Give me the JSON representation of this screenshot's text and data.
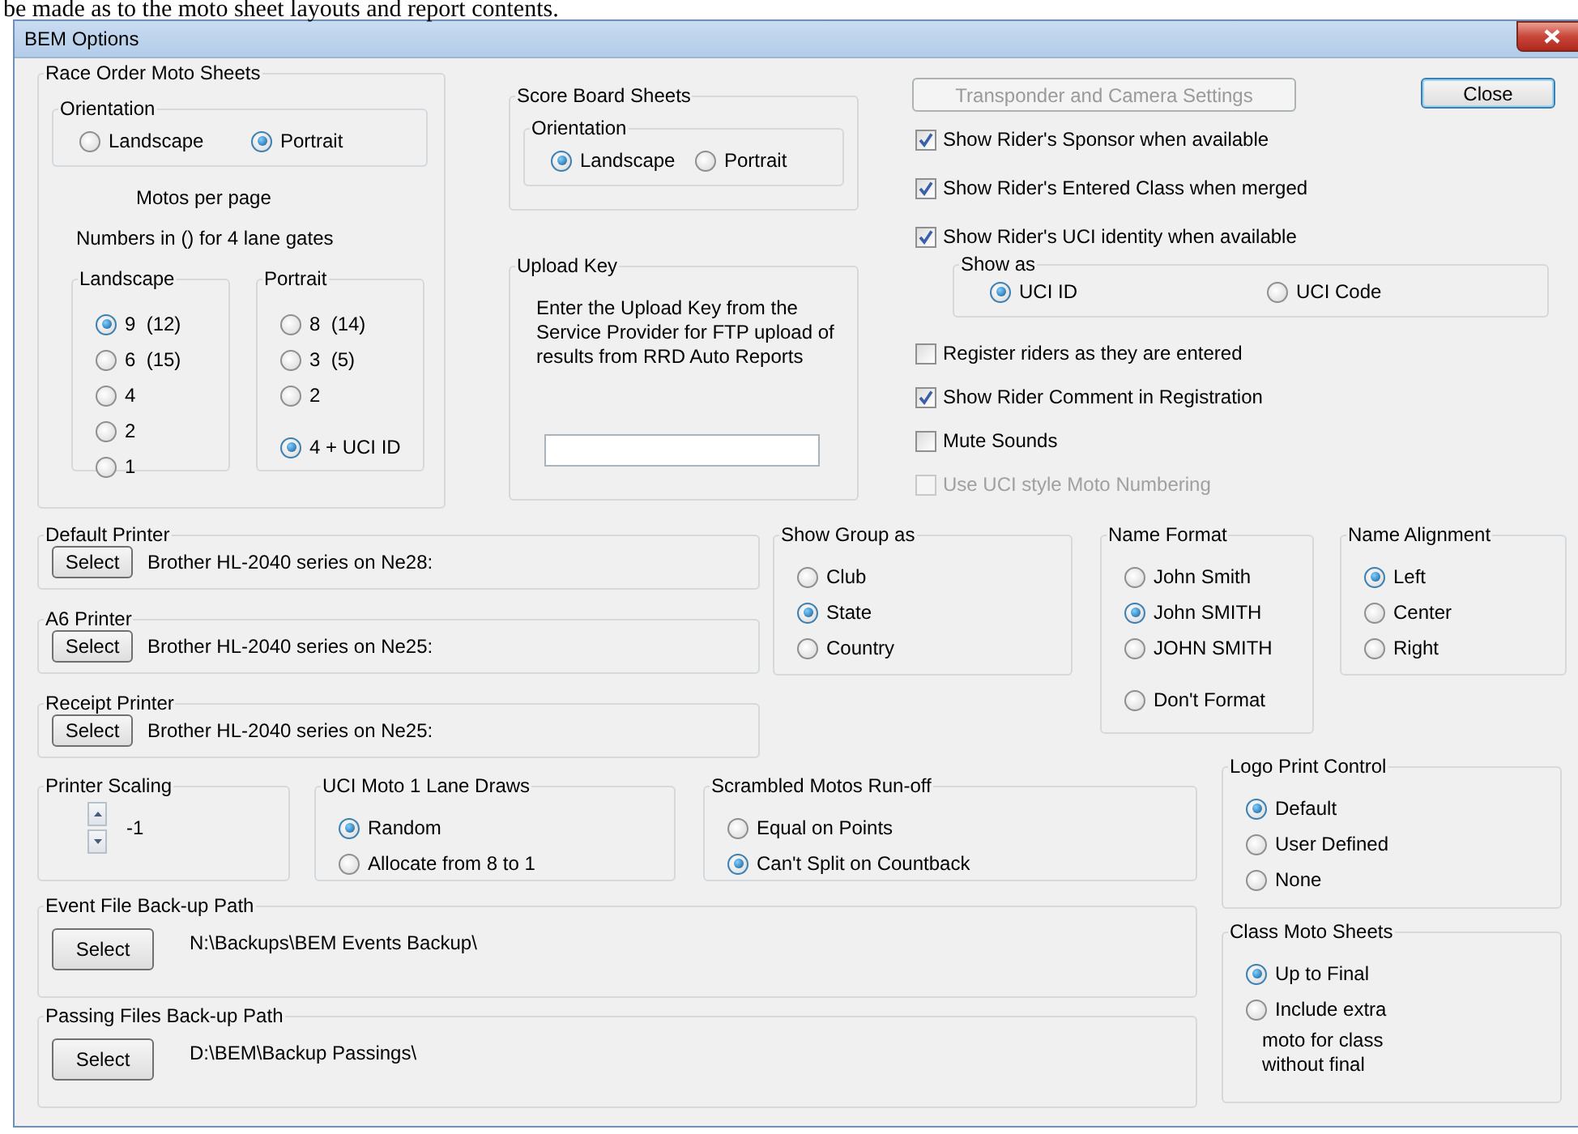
{
  "page_text": "be made as to the moto sheet layouts and report contents.",
  "window": {
    "title": "BEM Options"
  },
  "race_order": {
    "title": "Race Order Moto Sheets",
    "orientation": {
      "title": "Orientation",
      "options": [
        {
          "label": "Landscape",
          "selected": false
        },
        {
          "label": "Portrait",
          "selected": true
        }
      ]
    },
    "motos_label": "Motos per page",
    "numbers_note": "Numbers in () for 4 lane gates",
    "landscape": {
      "title": "Landscape",
      "options": [
        {
          "label": "9  (12)",
          "selected": true
        },
        {
          "label": "6  (15)",
          "selected": false
        },
        {
          "label": "4",
          "selected": false
        },
        {
          "label": "2",
          "selected": false
        },
        {
          "label": "1",
          "selected": false
        }
      ]
    },
    "portrait": {
      "title": "Portrait",
      "options": [
        {
          "label": "8  (14)",
          "selected": false
        },
        {
          "label": "3  (5)",
          "selected": false
        },
        {
          "label": "2",
          "selected": false
        },
        {
          "label": "4 + UCI ID",
          "selected": true
        }
      ]
    }
  },
  "score_board": {
    "title": "Score Board Sheets",
    "orientation": {
      "title": "Orientation",
      "options": [
        {
          "label": "Landscape",
          "selected": true
        },
        {
          "label": "Portrait",
          "selected": false
        }
      ]
    }
  },
  "upload_key": {
    "title": "Upload Key",
    "text": "Enter the Upload Key from the Service Provider for FTP upload of results from RRD Auto Reports"
  },
  "transponder_button": {
    "label": "Transponder and Camera Settings",
    "disabled": true
  },
  "close_button": {
    "label": "Close"
  },
  "settings": [
    {
      "kind": "checkbox",
      "label": "Show Rider's Sponsor when available",
      "checked": true,
      "disabled": false
    },
    {
      "kind": "checkbox",
      "label": "Show Rider's Entered Class when merged",
      "checked": true,
      "disabled": false
    },
    {
      "kind": "checkbox",
      "label": "Show Rider's UCI identity when available",
      "checked": true,
      "disabled": false
    },
    {
      "kind": "group",
      "title": "Show as",
      "options": [
        {
          "label": "UCI ID",
          "selected": true
        },
        {
          "label": "UCI Code",
          "selected": false
        }
      ]
    },
    {
      "kind": "checkbox",
      "label": "Register riders as they are entered",
      "checked": false,
      "disabled": false
    },
    {
      "kind": "checkbox",
      "label": "Show Rider Comment in Registration",
      "checked": true,
      "disabled": false
    },
    {
      "kind": "checkbox",
      "label": "Mute Sounds",
      "checked": false,
      "disabled": false
    },
    {
      "kind": "checkbox",
      "label": "Use UCI style Moto Numbering",
      "checked": false,
      "disabled": true
    }
  ],
  "printers": [
    {
      "title": "Default Printer",
      "button": "Select",
      "value": "Brother HL-2040 series on Ne28:"
    },
    {
      "title": "A6 Printer",
      "button": "Select",
      "value": "Brother HL-2040 series on Ne25:"
    },
    {
      "title": "Receipt Printer",
      "button": "Select",
      "value": "Brother HL-2040 series on Ne25:"
    }
  ],
  "show_group_as": {
    "title": "Show Group as",
    "options": [
      {
        "label": "Club",
        "selected": false
      },
      {
        "label": "State",
        "selected": true
      },
      {
        "label": "Country",
        "selected": false
      }
    ]
  },
  "name_format": {
    "title": "Name Format",
    "options": [
      {
        "label": "John Smith",
        "selected": false
      },
      {
        "label": "John SMITH",
        "selected": true
      },
      {
        "label": "JOHN SMITH",
        "selected": false
      },
      {
        "label": "Don't Format",
        "selected": false
      }
    ]
  },
  "name_alignment": {
    "title": "Name Alignment",
    "options": [
      {
        "label": "Left",
        "selected": true
      },
      {
        "label": "Center",
        "selected": false
      },
      {
        "label": "Right",
        "selected": false
      }
    ]
  },
  "printer_scaling": {
    "title": "Printer Scaling",
    "value": "-1"
  },
  "uci_draws": {
    "title": "UCI Moto 1 Lane Draws",
    "options": [
      {
        "label": "Random",
        "selected": true
      },
      {
        "label": "Allocate from 8 to 1",
        "selected": false
      }
    ]
  },
  "scrambled": {
    "title": "Scrambled Motos Run-off",
    "options": [
      {
        "label": "Equal on Points",
        "selected": false
      },
      {
        "label": "Can't Split on Countback",
        "selected": true
      }
    ]
  },
  "event_file": {
    "title": "Event File Back-up Path",
    "button": "Select",
    "value": "N:\\Backups\\BEM Events Backup\\"
  },
  "passing_files": {
    "title": "Passing Files Back-up Path",
    "button": "Select",
    "value": "D:\\BEM\\Backup Passings\\"
  },
  "logo_print": {
    "title": "Logo Print Control",
    "options": [
      {
        "label": "Default",
        "selected": true
      },
      {
        "label": "User Defined",
        "selected": false
      },
      {
        "label": "None",
        "selected": false
      }
    ]
  },
  "class_moto": {
    "title": "Class Moto Sheets",
    "options": [
      {
        "label": "Up to Final",
        "selected": true
      },
      {
        "label": "Include extra",
        "selected": false
      }
    ],
    "note": "moto for class without final"
  }
}
